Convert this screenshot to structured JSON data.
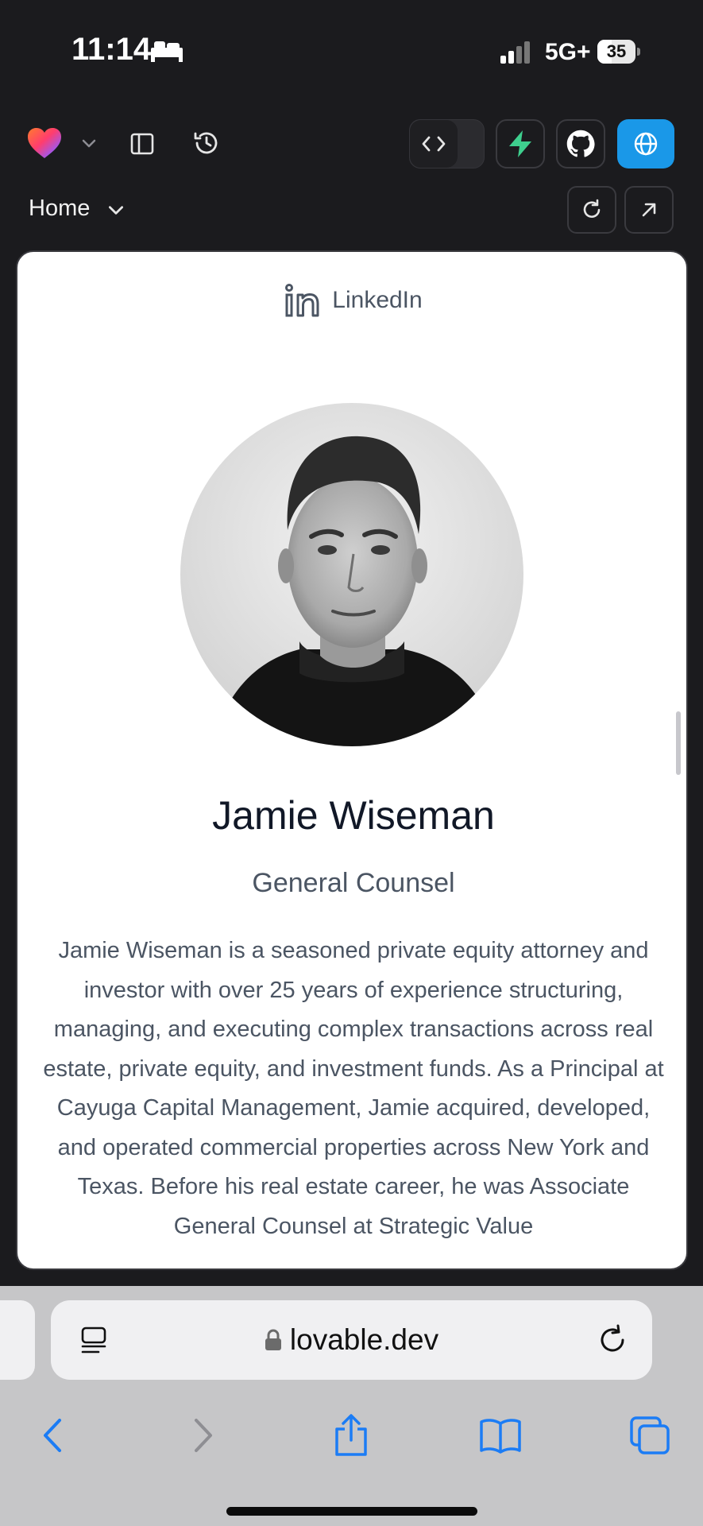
{
  "status_bar": {
    "time": "11:14",
    "network": "5G+",
    "battery": "35"
  },
  "toolbar": {
    "page_label": "Home"
  },
  "profile": {
    "link_label": "LinkedIn",
    "name": "Jamie Wiseman",
    "role": "General Counsel",
    "bio": "Jamie Wiseman is a seasoned private equity attorney and investor with over 25 years of experience structuring, managing, and executing complex transactions across real estate, private equity, and investment funds. As a Principal at Cayuga Capital Management, Jamie acquired, developed, and operated commercial properties across New York and Texas. Before his real estate career, he was Associate General Counsel at Strategic Value"
  },
  "browser": {
    "url": "lovable.dev"
  },
  "colors": {
    "accent": "#1a98e8",
    "bolt": "#3ecf8e",
    "safari_blue": "#1b7cf5"
  },
  "icons": [
    "bed-icon",
    "lovable-heart-icon",
    "chevron-down-icon",
    "sidebar-icon",
    "history-icon",
    "code-icon",
    "bolt-icon",
    "github-icon",
    "globe-icon",
    "reload-icon",
    "open-external-icon",
    "linkedin-icon",
    "reader-icon",
    "lock-icon",
    "back-icon",
    "forward-icon",
    "share-icon",
    "bookmarks-icon",
    "tabs-icon"
  ]
}
